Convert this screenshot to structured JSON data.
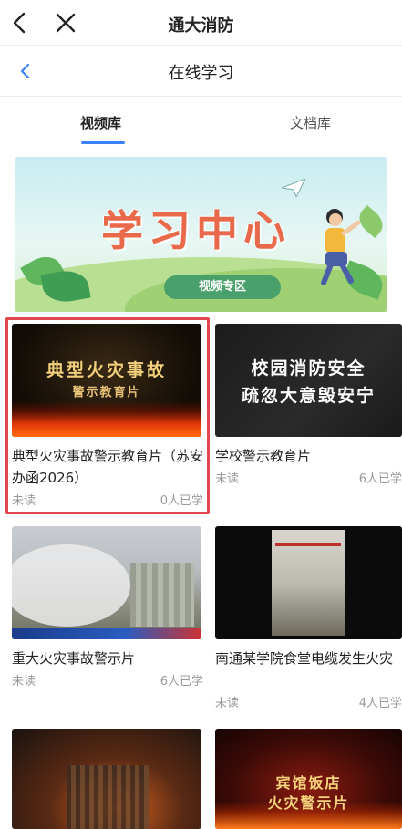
{
  "app": {
    "title": "通大消防"
  },
  "page": {
    "title": "在线学习"
  },
  "tabs": [
    {
      "label": "视频库",
      "active": true
    },
    {
      "label": "文档库",
      "active": false
    }
  ],
  "banner": {
    "title": "学习中心",
    "badge": "视频专区"
  },
  "videos": [
    {
      "title": "典型火灾事故警示教育片（苏安办函2026）",
      "thumb_line1": "典型火灾事故",
      "thumb_line2": "警示教育片",
      "status": "未读",
      "count": "0人已学"
    },
    {
      "title": "学校警示教育片",
      "thumb_line1": "校园消防安全",
      "thumb_line2": "疏忽大意毁安宁",
      "status": "未读",
      "count": "6人已学"
    },
    {
      "title": "重大火灾事故警示片",
      "status": "未读",
      "count": "6人已学"
    },
    {
      "title": "南通某学院食堂电缆发生火灾",
      "status": "未读",
      "count": "4人已学"
    },
    {
      "title": "",
      "status": "",
      "count": ""
    },
    {
      "title": "",
      "thumb_line1": "宾馆饭店",
      "thumb_line2": "火灾警示片",
      "status": "",
      "count": ""
    }
  ],
  "colors": {
    "accent": "#3b82f6",
    "highlight": "#e2474f",
    "muted": "#999999"
  }
}
